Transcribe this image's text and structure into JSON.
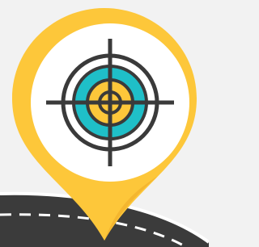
{
  "colors": {
    "background": "#f2f2f2",
    "pin_yellow": "#fdc73a",
    "pin_yellow_dark": "#f4b62f",
    "pin_inner_white": "#ffffff",
    "target_outline": "#3a3a3a",
    "target_teal": "#1fbfc8",
    "target_yellow": "#fdc73a",
    "road_dark": "#3b3b3b",
    "road_edge": "#ffffff",
    "road_dash": "#ffffff"
  },
  "icons": {
    "pin": "map-pin-icon",
    "target": "crosshair-target-icon",
    "road": "curved-road-icon"
  }
}
